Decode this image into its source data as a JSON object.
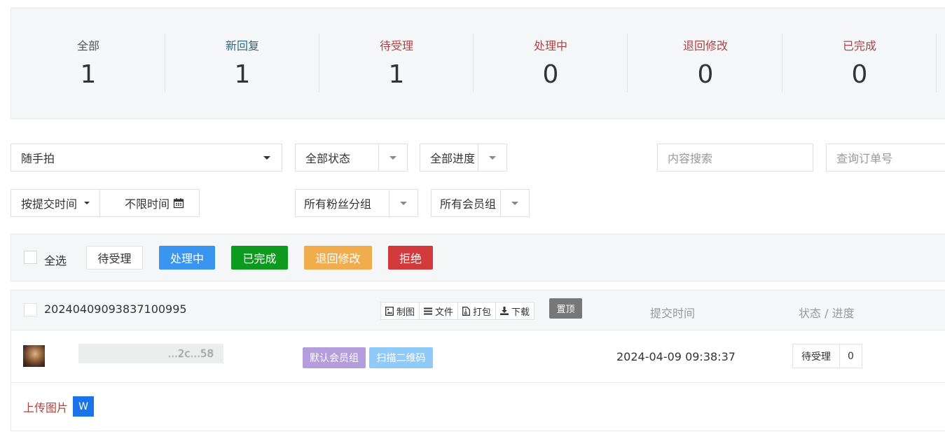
{
  "stats": [
    {
      "label": "全部",
      "value": "1",
      "color": "#555555"
    },
    {
      "label": "新回复",
      "value": "1",
      "color": "#2c6b8a"
    },
    {
      "label": "待受理",
      "value": "1",
      "color": "#a94442"
    },
    {
      "label": "处理中",
      "value": "0",
      "color": "#a94442"
    },
    {
      "label": "退回修改",
      "value": "0",
      "color": "#a94442"
    },
    {
      "label": "已完成",
      "value": "0",
      "color": "#a94442"
    }
  ],
  "filters": {
    "category": "随手拍",
    "status": "全部状态",
    "progress": "全部进度",
    "content_search_placeholder": "内容搜索",
    "order_search_placeholder": "查询订单号",
    "time_sort": "按提交时间",
    "time_range": "不限时间",
    "fans_group": "所有粉丝分组",
    "member_group": "所有会员组"
  },
  "actions": {
    "select_all": "全选",
    "pending": "待受理",
    "processing": "处理中",
    "completed": "已完成",
    "returned": "退回修改",
    "reject": "拒绝"
  },
  "order": {
    "id": "20240409093837100995",
    "tools": [
      "制图",
      "文件",
      "打包",
      "下载"
    ],
    "pin": "置顶",
    "col_submit_time": "提交时间",
    "col_status": "状态 / 进度",
    "user_name": "...2c...58",
    "tags": [
      "默认会员组",
      "扫描二维码"
    ],
    "submit_time": "2024-04-09 09:38:37",
    "status": "待受理",
    "progress": "0",
    "upload_label": "上传图片",
    "upload_badge": "W"
  }
}
